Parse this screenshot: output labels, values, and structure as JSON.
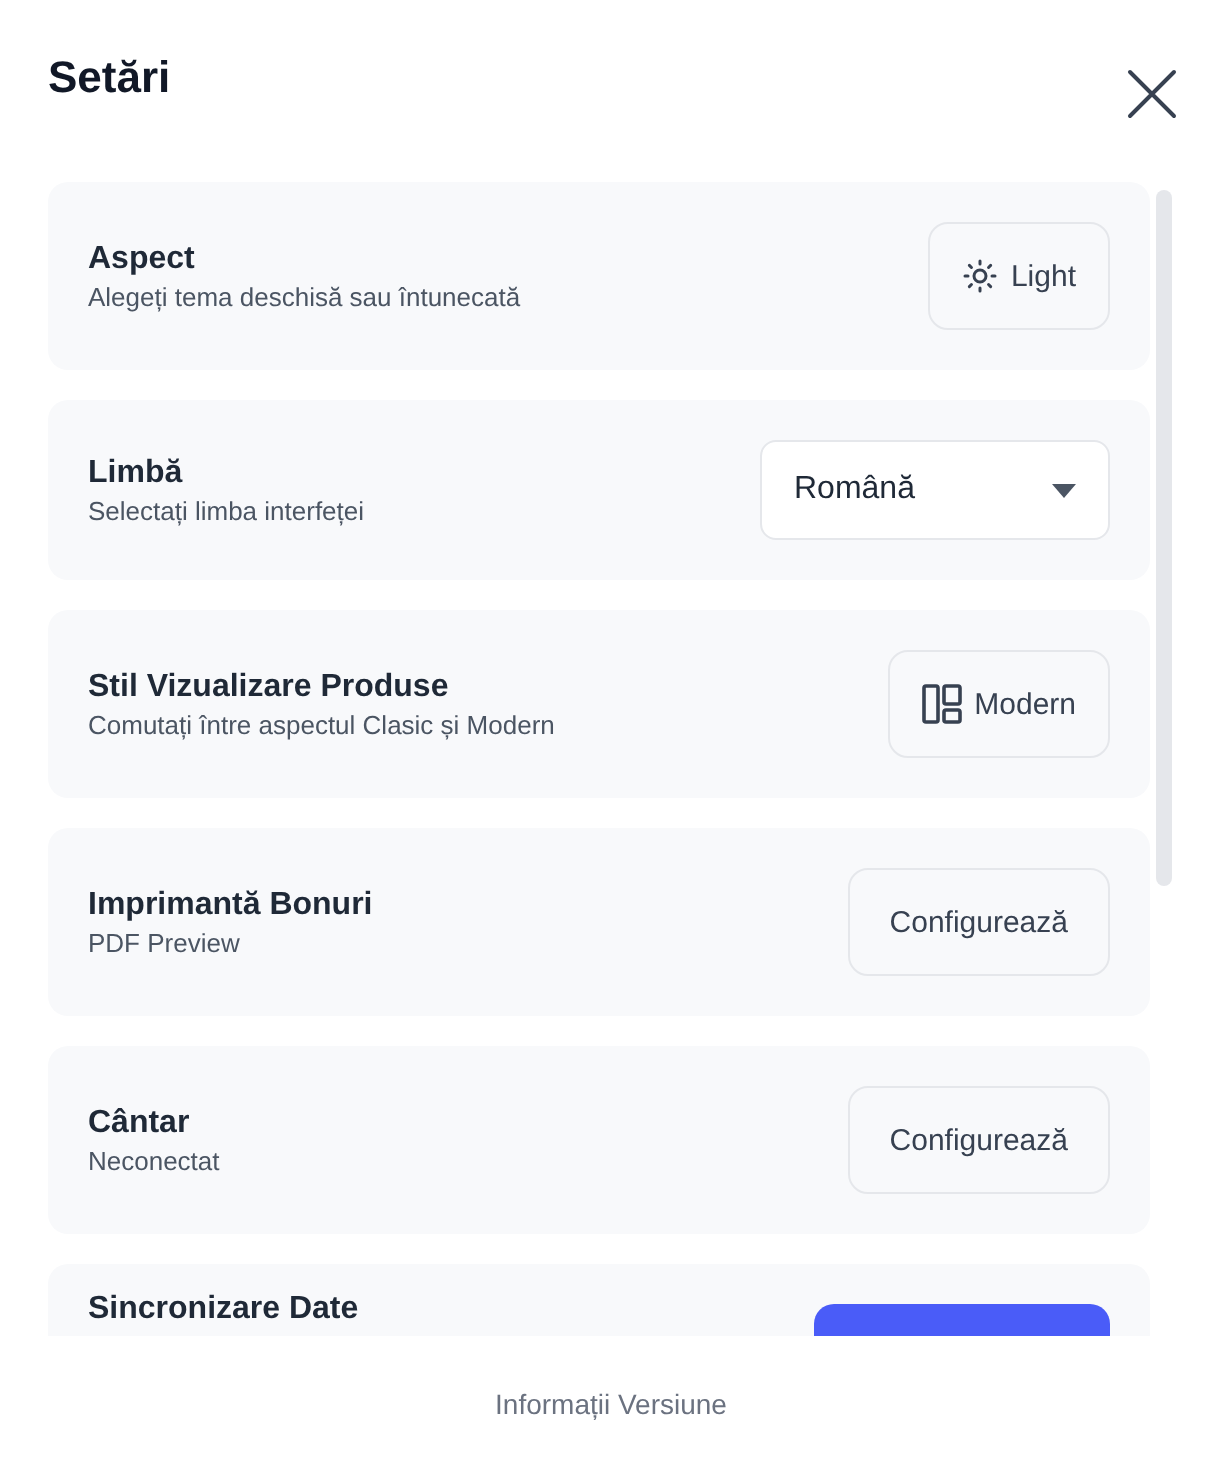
{
  "title": "Setări",
  "settings": [
    {
      "title": "Aspect",
      "subtitle": "Alegeți tema deschisă sau întunecată",
      "control": {
        "kind": "sun-button",
        "label": "Light"
      }
    },
    {
      "title": "Limbă",
      "subtitle": "Selectați limba interfeței",
      "control": {
        "kind": "select",
        "label": "Română"
      }
    },
    {
      "title": "Stil Vizualizare Produse",
      "subtitle": "Comutați între aspectul Clasic și Modern",
      "control": {
        "kind": "layout-button",
        "label": "Modern"
      }
    },
    {
      "title": "Imprimantă Bonuri",
      "subtitle": "PDF Preview",
      "control": {
        "kind": "button",
        "label": "Configurează"
      }
    },
    {
      "title": "Cântar",
      "subtitle": "Neconectat",
      "control": {
        "kind": "button",
        "label": "Configurează"
      }
    },
    {
      "title": "Sincronizare Date",
      "control": {
        "kind": "primary-button"
      }
    }
  ],
  "footer_link": "Informații Versiune"
}
